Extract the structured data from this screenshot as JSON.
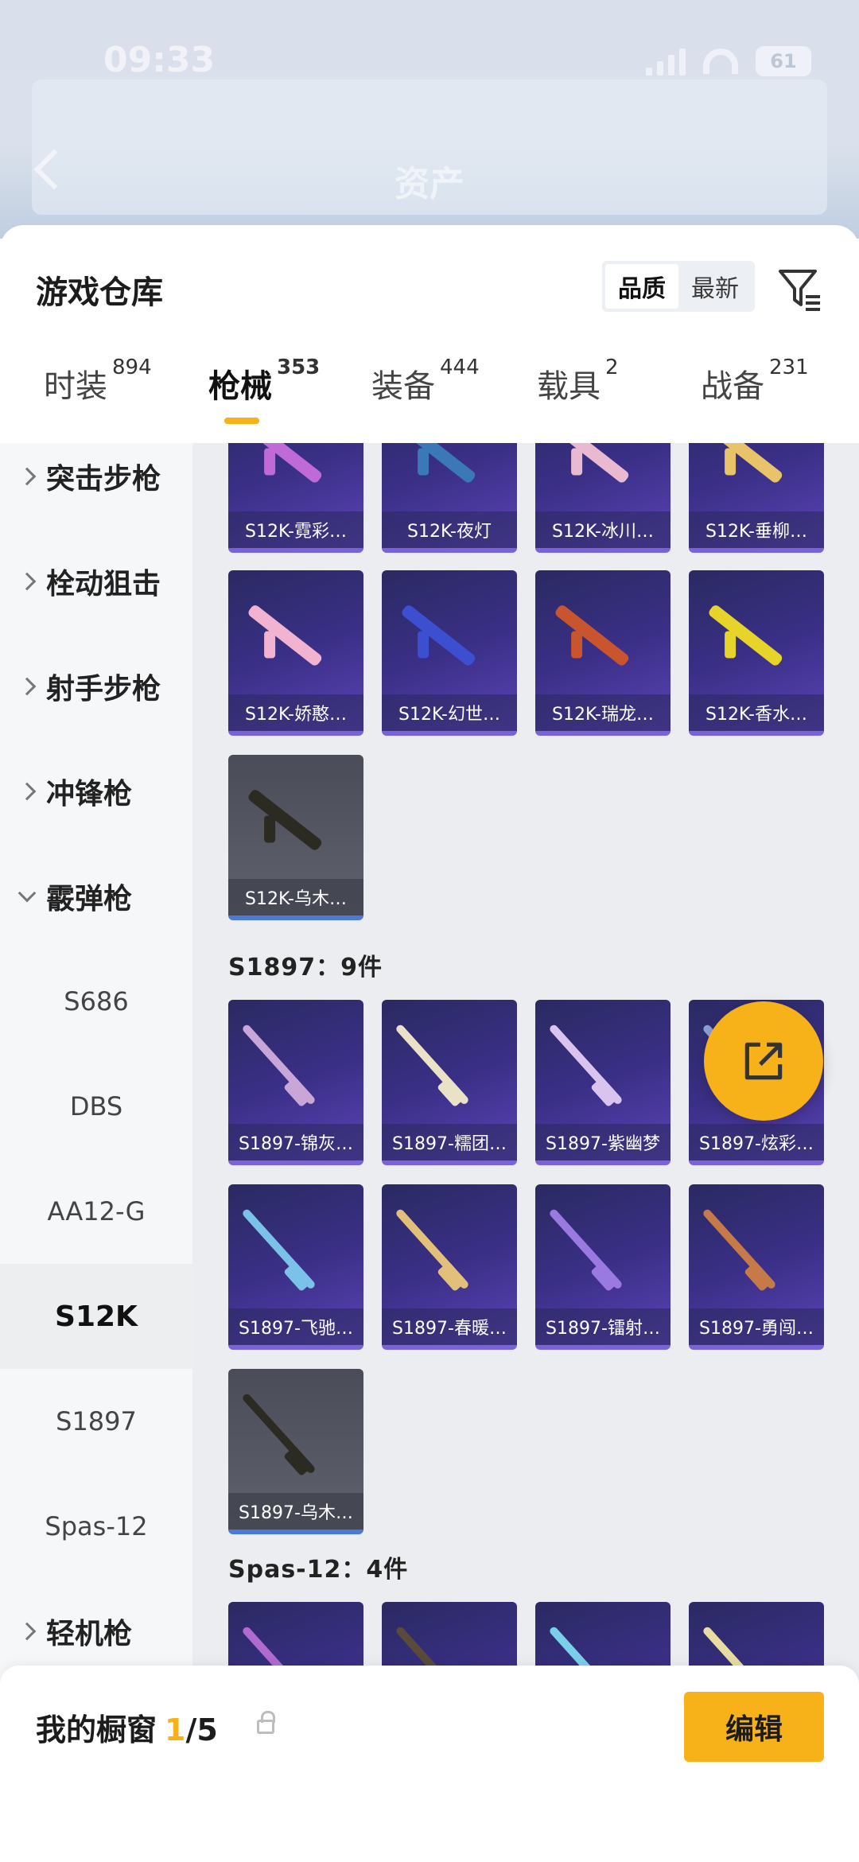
{
  "status_bar": {
    "time": "09:33",
    "battery": "61"
  },
  "background_header": {
    "title": "资产"
  },
  "sheet": {
    "title": "游戏仓库",
    "sort": {
      "options": [
        "品质",
        "最新"
      ],
      "active": "品质"
    }
  },
  "tabs": [
    {
      "label": "时装",
      "count": "894"
    },
    {
      "label": "枪械",
      "count": "353"
    },
    {
      "label": "装备",
      "count": "444"
    },
    {
      "label": "载具",
      "count": "2"
    },
    {
      "label": "战备",
      "count": "231"
    }
  ],
  "active_tab": "枪械",
  "sidebar": {
    "categories": [
      "突击步枪",
      "栓动狙击",
      "射手步枪",
      "冲锋枪",
      "霰弹枪",
      "轻机枪"
    ],
    "shotgun_subcategories": [
      "S686",
      "DBS",
      "AA12-G",
      "S12K",
      "S1897",
      "Spas-12"
    ],
    "active_sub": "S12K"
  },
  "grid": {
    "s12k_partial_row": [
      "S12K-霓彩…",
      "S12K-夜灯",
      "S12K-冰川…",
      "S12K-垂柳…"
    ],
    "s12k_row2": [
      "S12K-娇憨…",
      "S12K-幻世…",
      "S12K-瑞龙…",
      "S12K-香水…"
    ],
    "s12k_row3": [
      "S12K-乌木…"
    ],
    "s1897_header": "S1897：9件",
    "s1897_row1": [
      "S1897-锦灰…",
      "S1897-糯团…",
      "S1897-紫幽梦",
      "S1897-炫彩…"
    ],
    "s1897_row2": [
      "S1897-飞驰…",
      "S1897-春暖…",
      "S1897-镭射…",
      "S1897-勇闯…"
    ],
    "s1897_row3": [
      "S1897-乌木…"
    ],
    "spas_header": "Spas-12：4件"
  },
  "bottom_bar": {
    "label": "我的橱窗",
    "current": "1",
    "total": "/5",
    "edit_label": "编辑"
  },
  "colors": {
    "accent": "#f7b21a",
    "card_purple": "#3a2f86",
    "card_gray": "#5f616c"
  }
}
